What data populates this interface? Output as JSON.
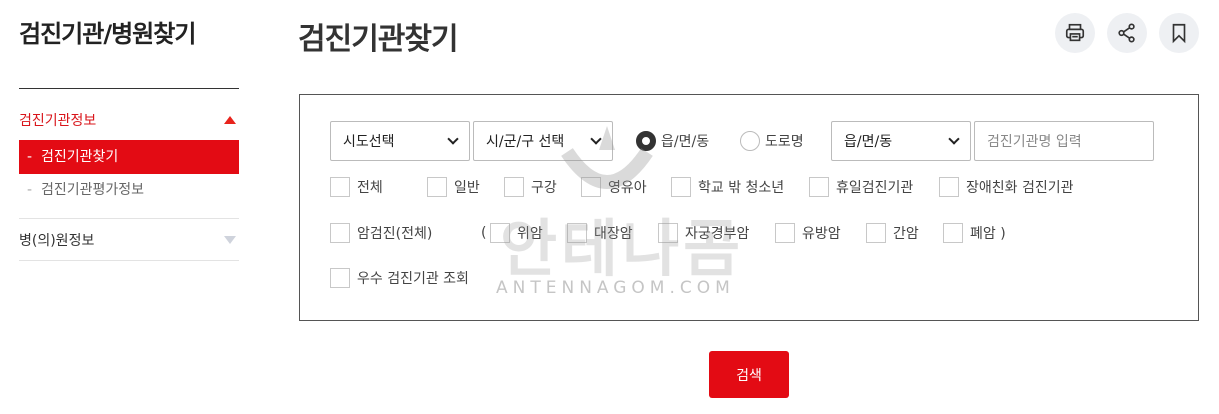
{
  "sidebar": {
    "title": "검진기관/병원찾기",
    "groups": [
      {
        "label": "검진기관정보",
        "sub": [
          "검진기관찾기",
          "검진기관평가정보"
        ]
      },
      {
        "label": "병(의)원정보"
      }
    ]
  },
  "header": {
    "title": "검진기관찾기",
    "icons": [
      "print-icon",
      "share-icon",
      "bookmark-icon"
    ]
  },
  "search": {
    "sido": "시도선택",
    "sigungu": "시/군/구 선택",
    "radio_eupmyeondong": "읍/면/동",
    "radio_doro": "도로명",
    "eup_select": "읍/면/동",
    "name_placeholder": "검진기관명 입력",
    "row1": [
      "전체",
      "일반",
      "구강",
      "영유아",
      "학교 밖 청소년",
      "휴일검진기관",
      "장애친화 검진기관"
    ],
    "row2_all": "암검진(전체)",
    "row2_open": "(",
    "row2": [
      "위암",
      "대장암",
      "자궁경부암",
      "유방암",
      "간암",
      "폐암 )"
    ],
    "row3": [
      "우수 검진기관 조회"
    ],
    "button": "검색"
  },
  "watermark": {
    "text": "안테나곰",
    "sub": "ANTENNAGOM.COM"
  },
  "colors": {
    "accent": "#e30b14",
    "border": "#555555"
  }
}
